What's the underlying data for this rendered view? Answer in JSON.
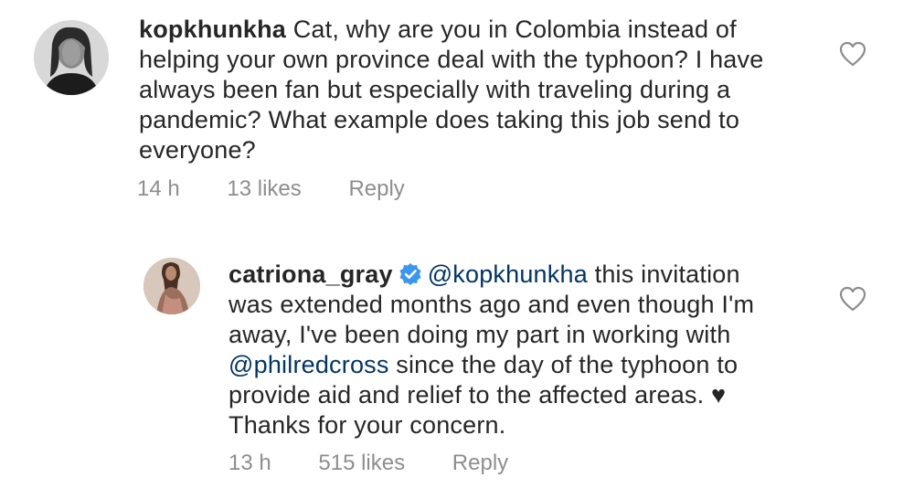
{
  "comments": [
    {
      "username": "kopkhunkha",
      "lines": [
        " Cat, why are you in Colombia instead of",
        "helping your own province deal with the typhoon? I have",
        "always been fan but especially with traveling during a",
        "pandemic? What example does taking this job send to",
        "everyone?"
      ],
      "time": "14 h",
      "likes": "13 likes",
      "reply": "Reply",
      "avatar_icon": "user-avatar-grayscale",
      "like_icon": "heart-outline-icon"
    },
    {
      "username": "catriona_gray",
      "verified_icon": "verified-badge-icon",
      "verified_color": "#3897f0",
      "line1_mention": "@kopkhunkha",
      "line1_rest": " this invitation",
      "line2": "was extended months ago and even though I'm",
      "line3": "away, I've been doing my part in working with",
      "line4_mention": "@philredcross",
      "line4_rest": " since the day of the typhoon to",
      "line5": "provide aid and relief to the affected areas. ♥",
      "line6": "Thanks for your concern.",
      "time": "13 h",
      "likes": "515 likes",
      "reply": "Reply",
      "avatar_icon": "user-avatar-photo",
      "like_icon": "heart-outline-icon"
    }
  ],
  "colors": {
    "text": "#262626",
    "meta": "#8e8e8e",
    "mention": "#003569"
  }
}
